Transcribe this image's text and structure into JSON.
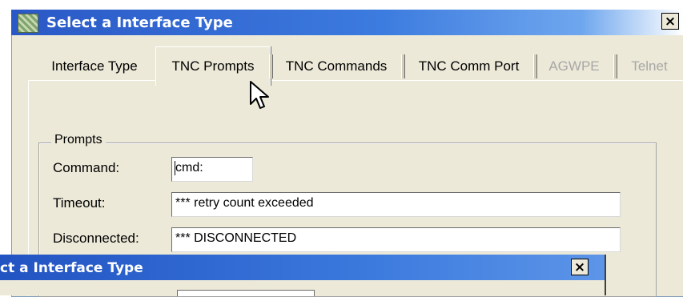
{
  "window": {
    "title": "Select a Interface Type",
    "close_label": "×"
  },
  "tabs": [
    {
      "label": "Interface Type",
      "state": "normal"
    },
    {
      "label": "TNC Prompts",
      "state": "selected"
    },
    {
      "label": "TNC Commands",
      "state": "normal"
    },
    {
      "label": "TNC Comm Port",
      "state": "normal"
    },
    {
      "label": "AGWPE",
      "state": "disabled"
    },
    {
      "label": "Telnet",
      "state": "disabled"
    }
  ],
  "prompts_group": {
    "legend": "Prompts",
    "fields": [
      {
        "label": "Command:",
        "value": "cmd:"
      },
      {
        "label": "Timeout:",
        "value": "*** retry count exceeded"
      },
      {
        "label": "Disconnected:",
        "value": "*** DISCONNECTED"
      }
    ]
  },
  "background_window": {
    "title": "ct a Interface Type",
    "close_label": "×"
  },
  "icons": {
    "app": "app-icon",
    "close": "close-icon",
    "cursor": "mouse-pointer-icon"
  },
  "colors": {
    "titlebar": "#2a58c6",
    "window_face": "#ece9d8",
    "disabled_text": "#a7a7a7"
  }
}
